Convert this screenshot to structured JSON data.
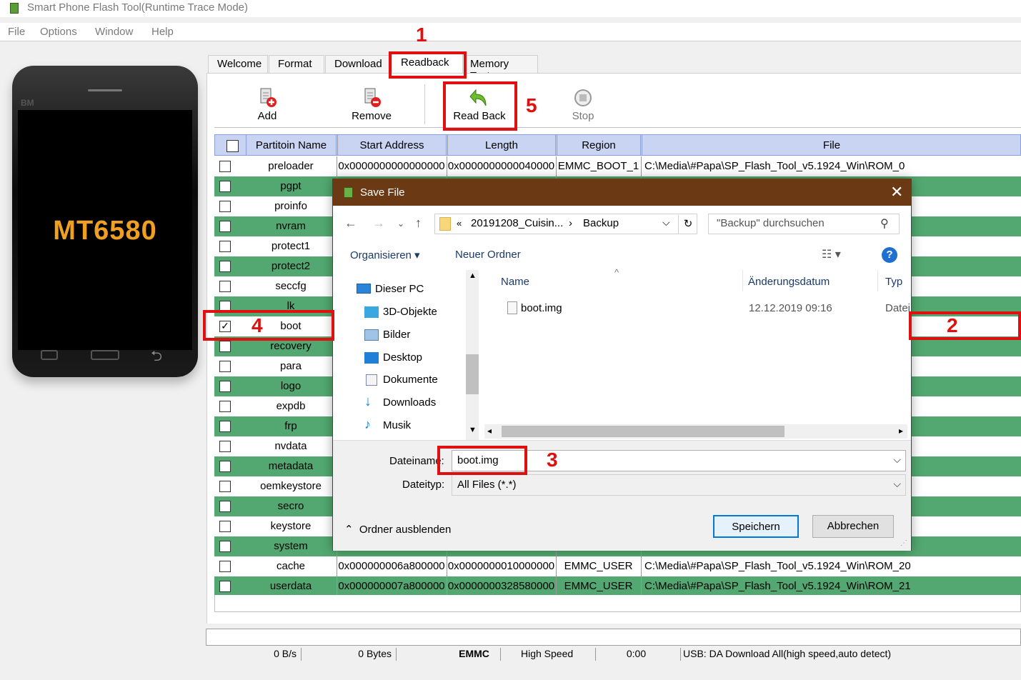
{
  "window": {
    "title": "Smart Phone Flash Tool(Runtime Trace Mode)"
  },
  "menu": [
    "File",
    "Options",
    "Window",
    "Help"
  ],
  "phone": {
    "brand": "BM",
    "model": "MT6580"
  },
  "tabs": [
    "Welcome",
    "Format",
    "Download",
    "Readback",
    "Memory Test"
  ],
  "toolbar": {
    "add": "Add",
    "remove": "Remove",
    "readback": "Read Back",
    "stop": "Stop"
  },
  "table": {
    "headers": [
      "Partitoin Name",
      "Start Address",
      "Length",
      "Region",
      "File"
    ],
    "rows": [
      {
        "name": "preloader",
        "start": "0x0000000000000000",
        "length": "0x0000000000040000",
        "region": "EMMC_BOOT_1",
        "file": "C:\\Media\\#Papa\\SP_Flash_Tool_v5.1924_Win\\ROM_0",
        "checked": false,
        "green": false
      },
      {
        "name": "pgpt",
        "green": true
      },
      {
        "name": "proinfo",
        "green": false
      },
      {
        "name": "nvram",
        "green": true
      },
      {
        "name": "protect1",
        "green": false
      },
      {
        "name": "protect2",
        "green": true
      },
      {
        "name": "seccfg",
        "green": false
      },
      {
        "name": "lk",
        "green": true
      },
      {
        "name": "boot",
        "checked": true,
        "green": false
      },
      {
        "name": "recovery",
        "green": true
      },
      {
        "name": "para",
        "green": false
      },
      {
        "name": "logo",
        "green": true
      },
      {
        "name": "expdb",
        "green": false
      },
      {
        "name": "frp",
        "green": true
      },
      {
        "name": "nvdata",
        "green": false
      },
      {
        "name": "metadata",
        "green": true
      },
      {
        "name": "oemkeystore",
        "green": false
      },
      {
        "name": "secro",
        "green": true
      },
      {
        "name": "keystore",
        "green": false
      },
      {
        "name": "system",
        "green": true
      },
      {
        "name": "cache",
        "start": "0x000000006a800000",
        "length": "0x0000000010000000",
        "region": "EMMC_USER",
        "file": "C:\\Media\\#Papa\\SP_Flash_Tool_v5.1924_Win\\ROM_20",
        "green": false
      },
      {
        "name": "userdata",
        "start": "0x000000007a800000",
        "length": "0x0000000328580000",
        "region": "EMMC_USER",
        "file": "C:\\Media\\#Papa\\SP_Flash_Tool_v5.1924_Win\\ROM_21",
        "green": true
      }
    ]
  },
  "status": {
    "rate": "0 B/s",
    "bytes": "0 Bytes",
    "storage": "EMMC",
    "speed": "High Speed",
    "time": "0:00",
    "usb": "USB: DA Download All(high speed,auto detect)"
  },
  "annotations": {
    "m1": "1",
    "m2": "2",
    "m3": "3",
    "m4": "4",
    "m5": "5"
  },
  "dialog": {
    "title": "Save File",
    "path_prefix": "«",
    "path_folder1": "20191208_Cuisin...",
    "path_sep": "›",
    "path_folder2": "Backup",
    "search_placeholder": "\"Backup\" durchsuchen",
    "organize": "Organisieren",
    "new_folder": "Neuer Ordner",
    "help": "?",
    "nav": [
      "Dieser PC",
      "3D-Objekte",
      "Bilder",
      "Desktop",
      "Dokumente",
      "Downloads",
      "Musik"
    ],
    "columns": {
      "name": "Name",
      "date": "Änderungsdatum",
      "type": "Typ"
    },
    "file": {
      "name": "boot.img",
      "date": "12.12.2019 09:16",
      "type": "Datei"
    },
    "filename_label": "Dateiname:",
    "filename_value": "boot.img",
    "filetype_label": "Dateityp:",
    "filetype_value": "All Files (*.*)",
    "hide_folders": "Ordner ausblenden",
    "save": "Speichern",
    "cancel": "Abbrechen"
  },
  "colors": {
    "green_row": "#52a870",
    "header": "#c9d4f2",
    "dialog_title": "#6b3a14",
    "annotation": "#e01010"
  }
}
